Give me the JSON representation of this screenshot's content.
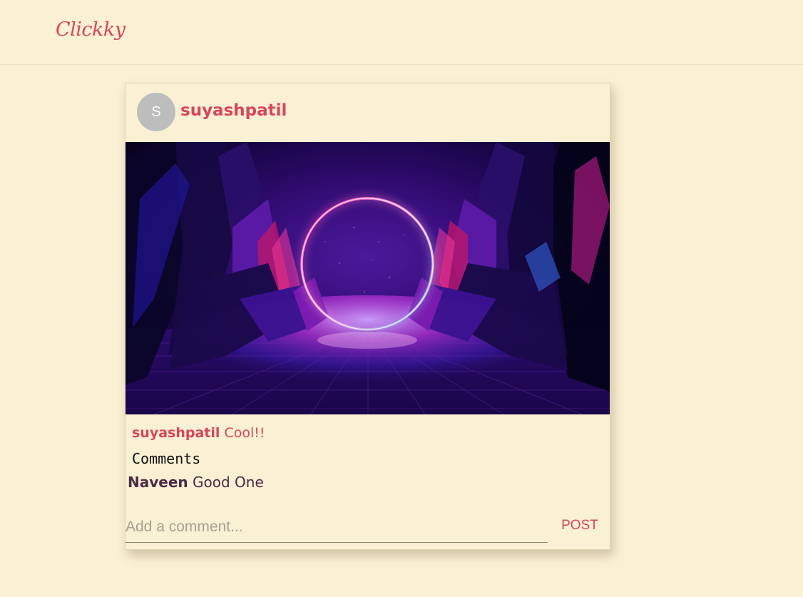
{
  "header": {
    "logo_text": "Clickky"
  },
  "post": {
    "avatar_letter": "S",
    "username": "suyashpatil",
    "caption": {
      "username": "suyashpatil",
      "text": "Cool!!"
    },
    "comments_heading": "Comments",
    "comments": [
      {
        "username": "Naveen",
        "text": "Good One"
      }
    ],
    "comment_input": {
      "placeholder": "Add a comment...",
      "value": ""
    },
    "post_button_label": "POST"
  }
}
